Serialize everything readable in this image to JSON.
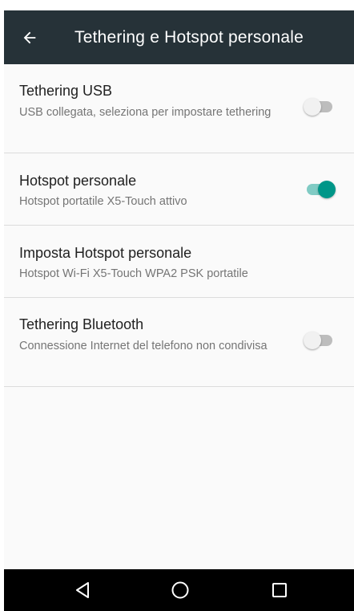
{
  "appbar": {
    "title": "Tethering e Hotspot personale",
    "back_icon": "arrow-back-icon"
  },
  "settings": [
    {
      "title": "Tethering USB",
      "subtitle": "USB collegata, seleziona per impostare tethering",
      "toggle": "off"
    },
    {
      "title": "Hotspot personale",
      "subtitle": "Hotspot portatile X5-Touch attivo",
      "toggle": "on"
    },
    {
      "title": "Imposta Hotspot personale",
      "subtitle": "Hotspot Wi-Fi X5-Touch WPA2 PSK portatile",
      "toggle": null
    },
    {
      "title": "Tethering Bluetooth",
      "subtitle": "Connessione Internet del telefono non condivisa",
      "toggle": "off"
    }
  ],
  "navbar": {
    "back_icon": "nav-back-triangle-icon",
    "home_icon": "nav-home-circle-icon",
    "recents_icon": "nav-recents-square-icon"
  },
  "colors": {
    "appbar": "#263238",
    "accent": "#009688",
    "accent_track": "#80cbc4",
    "background": "#fafafa",
    "navbar": "#000000"
  }
}
